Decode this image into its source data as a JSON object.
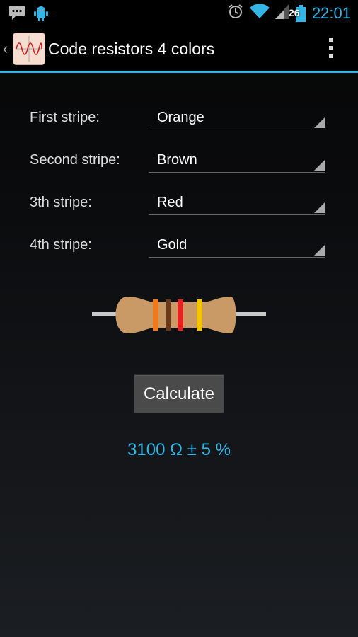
{
  "status_bar": {
    "time": "22:01",
    "battery_level": "26",
    "icons": [
      "chat-notification-icon",
      "android-debug-icon",
      "alarm-icon",
      "wifi-icon",
      "signal-icon",
      "battery-icon"
    ]
  },
  "action_bar": {
    "title": "Code resistors 4 colors",
    "accent": "#33b5e5"
  },
  "form": {
    "rows": [
      {
        "label": "First stripe:",
        "value": "Orange"
      },
      {
        "label": "Second stripe:",
        "value": "Brown"
      },
      {
        "label": "3th stripe:",
        "value": "Red"
      },
      {
        "label": "4th stripe:",
        "value": "Gold"
      }
    ]
  },
  "resistor": {
    "body_color": "#c99a66",
    "band_colors": [
      "#f07a1a",
      "#6b3a1a",
      "#e82020",
      "#f5c400"
    ]
  },
  "calculate_label": "Calculate",
  "result": "3100 Ω ± 5 %"
}
